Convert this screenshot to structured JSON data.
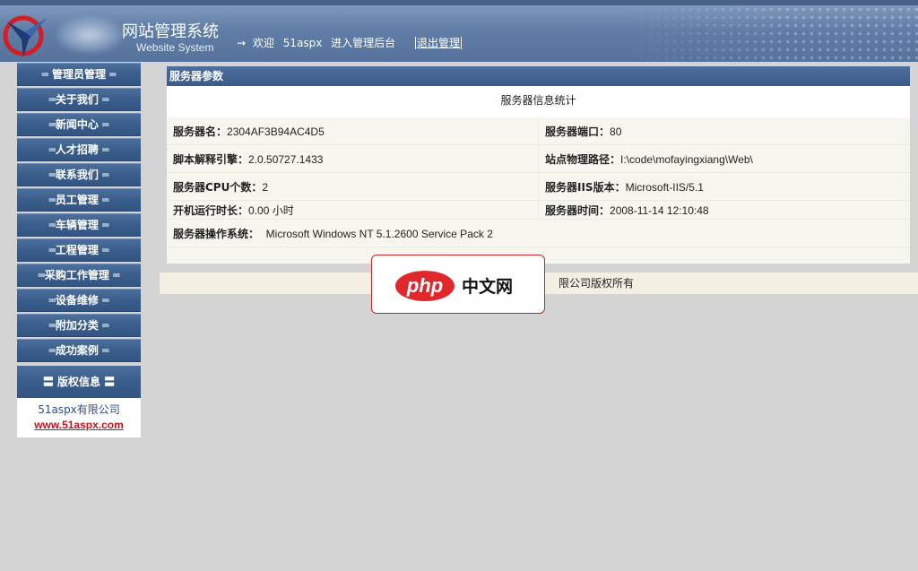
{
  "header": {
    "title": "网站管理系统",
    "subtitle": "Website System",
    "welcome_arrow": "→",
    "welcome_prefix": "欢迎",
    "username": "51aspx",
    "welcome_suffix": "进入管理后台",
    "logout_label": "退出管理"
  },
  "sidebar": {
    "items": [
      {
        "label": "═ 管理员管理 ═"
      },
      {
        "label": "═关于我们 ═"
      },
      {
        "label": "═新闻中心 ═"
      },
      {
        "label": "═人才招聘 ═"
      },
      {
        "label": "═联系我们 ═"
      },
      {
        "label": "═员工管理 ═"
      },
      {
        "label": "═车辆管理 ═"
      },
      {
        "label": "═工程管理 ═"
      },
      {
        "label": "═采购工作管理 ═"
      },
      {
        "label": "═设备维修 ═"
      },
      {
        "label": "═附加分类 ═"
      },
      {
        "label": "═成功案例 ═"
      }
    ],
    "copyright_title": "〓 版权信息 〓",
    "company": "51aspx有限公司",
    "company_url": "www.51aspx.com"
  },
  "main": {
    "panel_title": "服务器参数",
    "subtitle": "服务器信息统计",
    "rows": [
      {
        "l_label": "服务器名：",
        "l_value": "2304AF3B94AC4D5",
        "r_label": "服务器端口：",
        "r_value": "80"
      },
      {
        "l_label": "脚本解释引擎：",
        "l_value": "2.0.50727.1433",
        "r_label": "站点物理路径：",
        "r_value": "I:\\code\\mofayingxiang\\Web\\"
      },
      {
        "l_label": "服务器CPU个数：",
        "l_value": "2",
        "r_label": "服务器IIS版本：",
        "r_value": "Microsoft-IIS/5.1"
      },
      {
        "l_label": "开机运行时长：",
        "l_value": "0.00 小时",
        "r_label": "服务器时间：",
        "r_value": "2008-11-14 12:10:48"
      }
    ],
    "os_label": "服务器操作系统：",
    "os_value": "Microsoft Windows NT 5.1.2600 Service Pack 2"
  },
  "footer": {
    "text": "限公司版权所有"
  },
  "watermark": {
    "php": "php",
    "cn": "中文网"
  },
  "colors": {
    "nav_blue": "#3a5d8b",
    "header_blue": "#5f7da6",
    "page_gray": "#d4d4d4",
    "panel_bg": "#f7f6ee",
    "link_red": "#c0131b"
  }
}
